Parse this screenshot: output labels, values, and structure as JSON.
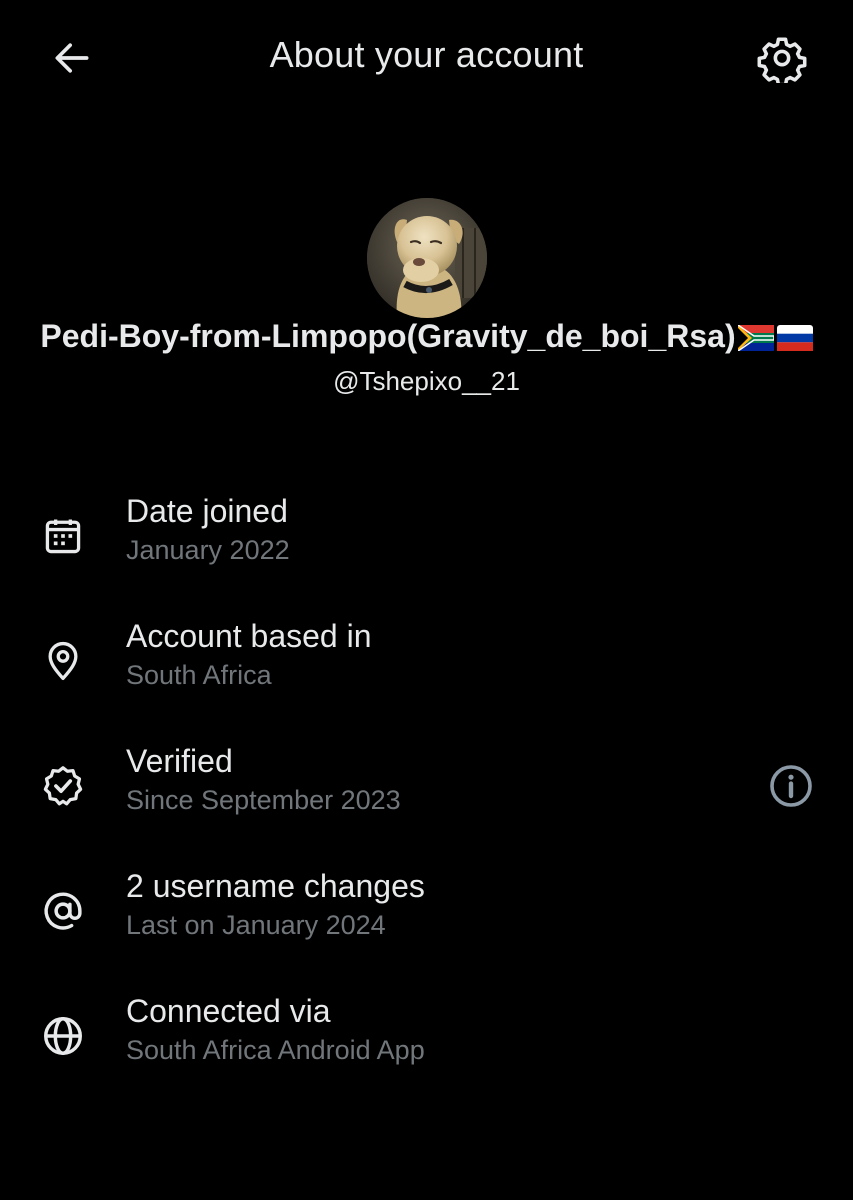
{
  "header": {
    "title": "About your account",
    "back_icon": "arrow-left-icon",
    "settings_icon": "gear-icon"
  },
  "profile": {
    "display_name": "Pedi-Boy-from-Limpopo(Gravity_de_boi_Rsa)",
    "flags": [
      "south-africa-flag",
      "russia-flag"
    ],
    "handle": "@Tshepixo__21",
    "avatar": "dog-avatar"
  },
  "rows": [
    {
      "icon": "calendar-icon",
      "label": "Date joined",
      "sub": "January 2022"
    },
    {
      "icon": "location-pin-icon",
      "label": "Account based in",
      "sub": "South Africa"
    },
    {
      "icon": "verified-badge-icon",
      "label": "Verified",
      "sub": "Since September 2023",
      "trailing_icon": "info-icon"
    },
    {
      "icon": "at-sign-icon",
      "label": "2 username changes",
      "sub": "Last on January 2024"
    },
    {
      "icon": "globe-icon",
      "label": "Connected via",
      "sub": "South Africa Android App"
    }
  ],
  "colors": {
    "background": "#000000",
    "primary_text": "#e7e9ea",
    "secondary_text": "#71767b"
  }
}
